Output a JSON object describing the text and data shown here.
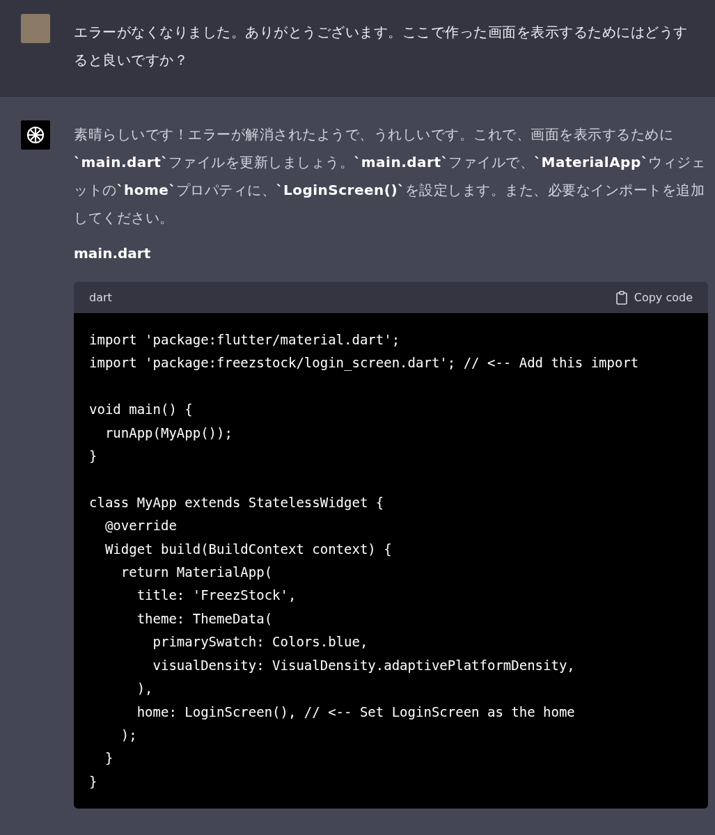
{
  "user_message": {
    "text": "エラーがなくなりました。ありがとうございます。ここで作った画面を表示するためにはどうすると良いですか？"
  },
  "assistant_message": {
    "text": "素晴らしいです！エラーが解消されたようで、うれしいです。これで、画面を表示するために**`main.dart`**ファイルを更新しましょう。**`main.dart`**ファイルで、**`MaterialApp`**ウィジェットの**`home`**プロパティに、**`LoginScreen()`**を設定します。また、必要なインポートを追加してください。",
    "file_heading": "main.dart",
    "code_block": {
      "language": "dart",
      "copy_label": "Copy code",
      "code": "import 'package:flutter/material.dart';\nimport 'package:freezstock/login_screen.dart'; // <-- Add this import\n\nvoid main() {\n  runApp(MyApp());\n}\n\nclass MyApp extends StatelessWidget {\n  @override\n  Widget build(BuildContext context) {\n    return MaterialApp(\n      title: 'FreezStock',\n      theme: ThemeData(\n        primarySwatch: Colors.blue,\n        visualDensity: VisualDensity.adaptivePlatformDensity,\n      ),\n      home: LoginScreen(), // <-- Set LoginScreen as the home\n    );\n  }\n}"
    }
  }
}
